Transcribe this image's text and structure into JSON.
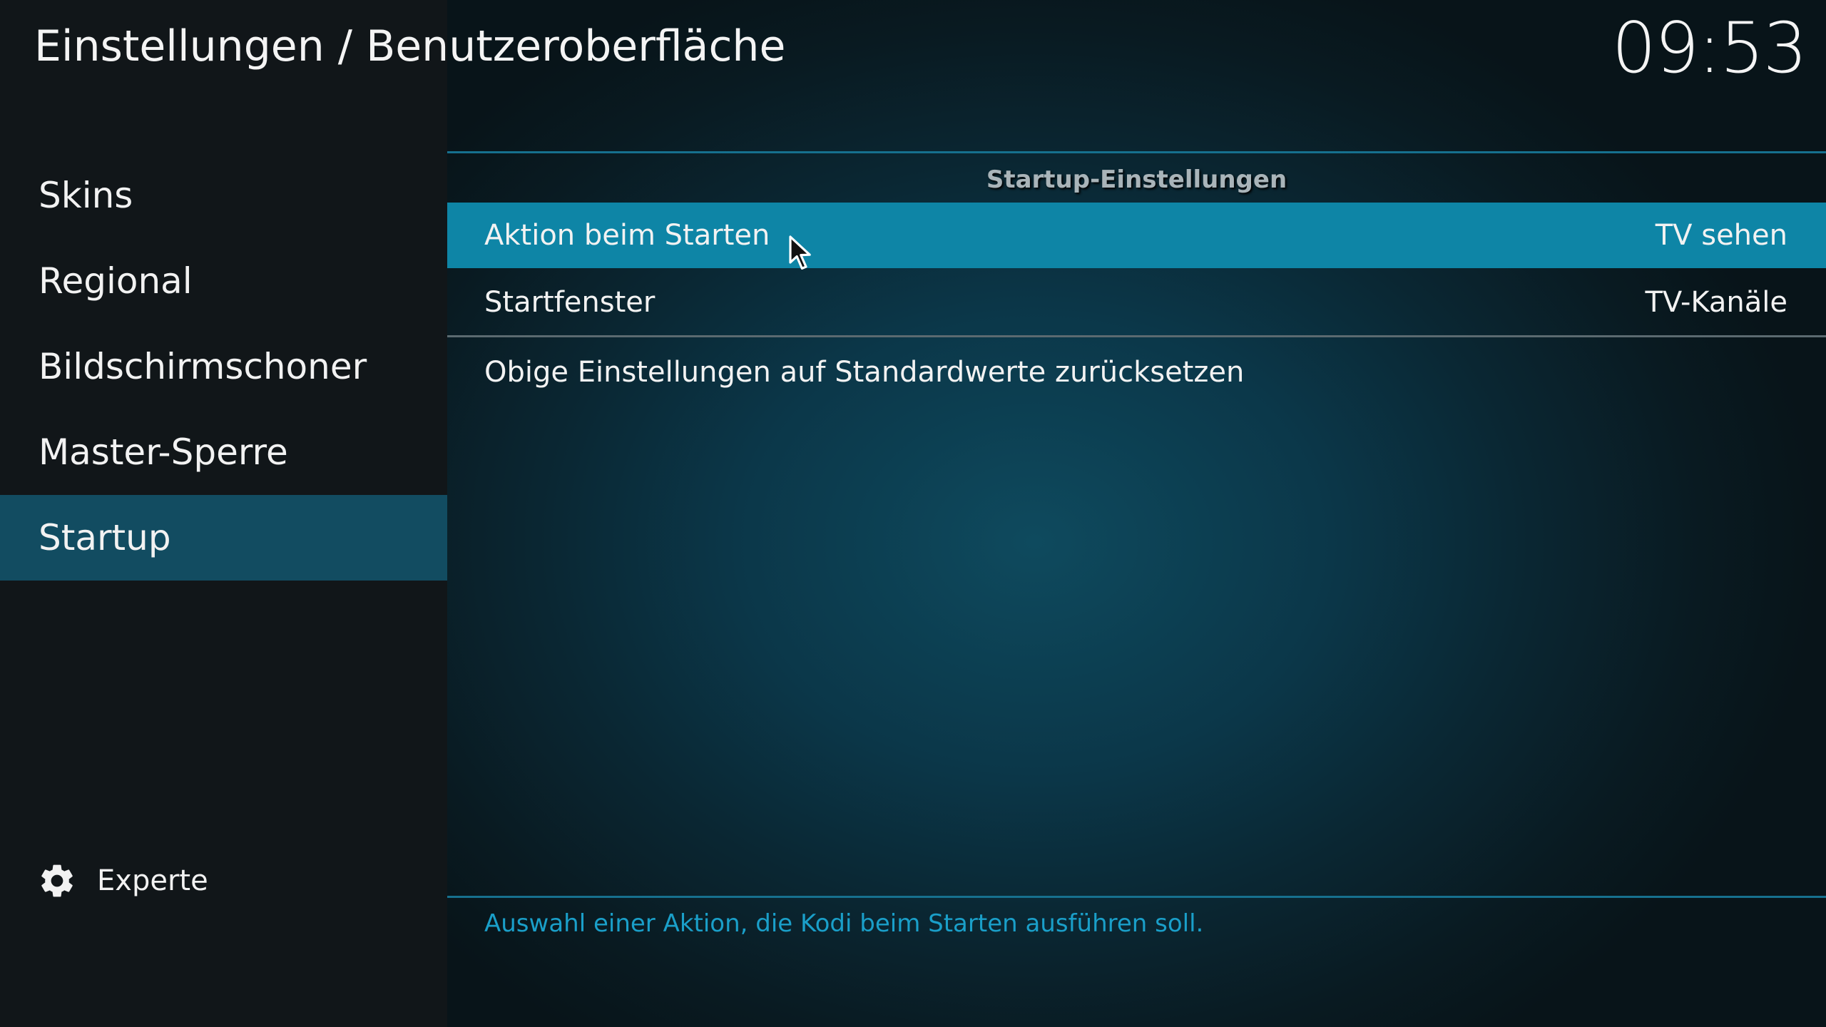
{
  "header": {
    "title": "Einstellungen / Benutzeroberfläche",
    "clock": "09:53"
  },
  "sidebar": {
    "items": [
      {
        "label": "Skins"
      },
      {
        "label": "Regional"
      },
      {
        "label": "Bildschirmschoner"
      },
      {
        "label": "Master-Sperre"
      },
      {
        "label": "Startup",
        "active": true
      }
    ],
    "level_label": "Experte",
    "level_icon": "gear-icon"
  },
  "main": {
    "section_title": "Startup-Einstellungen",
    "settings": [
      {
        "label": "Aktion beim Starten",
        "value": "TV sehen",
        "selected": true
      },
      {
        "label": "Startfenster",
        "value": "TV-Kanäle"
      }
    ],
    "reset_label": "Obige Einstellungen auf Standardwerte zurücksetzen",
    "help_text": "Auswahl einer Aktion, die Kodi beim Starten ausführen soll."
  },
  "colors": {
    "selection": "#0e85a6",
    "sidebar_active": "#124c61",
    "accent_line": "#16708e",
    "help_text": "#1a9fc9"
  }
}
